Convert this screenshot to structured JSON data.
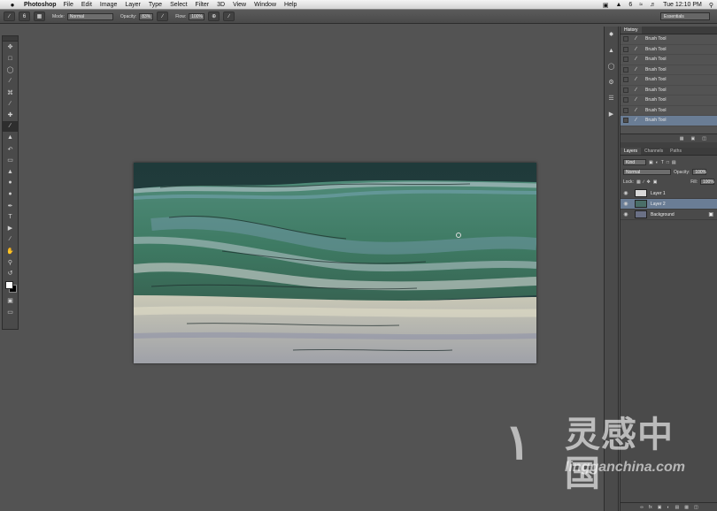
{
  "menubar": {
    "apple": "",
    "app_name": "Photoshop",
    "items": [
      "File",
      "Edit",
      "Image",
      "Layer",
      "Type",
      "Select",
      "Filter",
      "3D",
      "View",
      "Window",
      "Help"
    ],
    "right": {
      "badge": "6",
      "time": "Tue 12:10 PM"
    }
  },
  "options": {
    "mode_label": "Mode:",
    "mode_value": "Normal",
    "opacity_label": "Opacity:",
    "opacity_value": "83%",
    "flow_label": "Flow:",
    "flow_value": "100%",
    "brush_size": "6",
    "workspace": "Essentials"
  },
  "history": {
    "tab": "History",
    "items": [
      "Brush Tool",
      "Brush Tool",
      "Brush Tool",
      "Brush Tool",
      "Brush Tool",
      "Brush Tool",
      "Brush Tool",
      "Brush Tool",
      "Brush Tool"
    ]
  },
  "layers_panel": {
    "tabs": [
      "Layers",
      "Channels",
      "Paths"
    ],
    "kind": "Kind",
    "blend_mode": "Normal",
    "opacity_label": "Opacity:",
    "opacity_value": "100%",
    "lock_label": "Lock:",
    "fill_label": "Fill:",
    "fill_value": "100%",
    "layers": [
      {
        "name": "Layer 1",
        "thumb": "#d8d8d8"
      },
      {
        "name": "Layer 2",
        "thumb": "#4a6e68"
      },
      {
        "name": "Background",
        "thumb": "#6a7085"
      }
    ]
  },
  "watermark": {
    "text": "灵感中国",
    "url": "lingganchina.com"
  },
  "colors": {
    "canvas_bg": "#535353",
    "selection": "#6a7d95"
  }
}
